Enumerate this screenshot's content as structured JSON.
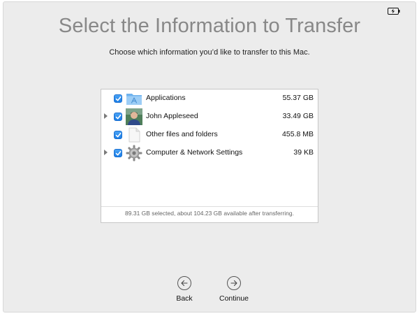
{
  "header": {
    "title": "Select the Information to Transfer",
    "subtitle": "Choose which information you’d like to transfer to this Mac."
  },
  "items": [
    {
      "label": "Applications",
      "size": "55.37 GB",
      "checked": true,
      "expandable": false,
      "icon": "applications-folder-icon"
    },
    {
      "label": "John Appleseed",
      "size": "33.49 GB",
      "checked": true,
      "expandable": true,
      "icon": "user-avatar-icon"
    },
    {
      "label": "Other files and folders",
      "size": "455.8 MB",
      "checked": true,
      "expandable": false,
      "icon": "document-icon"
    },
    {
      "label": "Computer & Network Settings",
      "size": "39 KB",
      "checked": true,
      "expandable": true,
      "icon": "gear-icon"
    }
  ],
  "summary": "89.31 GB selected, about 104.23 GB available after transferring.",
  "buttons": {
    "back": "Back",
    "continue": "Continue"
  },
  "colors": {
    "accent": "#1a7de6",
    "background": "#ececec",
    "title": "#888888"
  }
}
